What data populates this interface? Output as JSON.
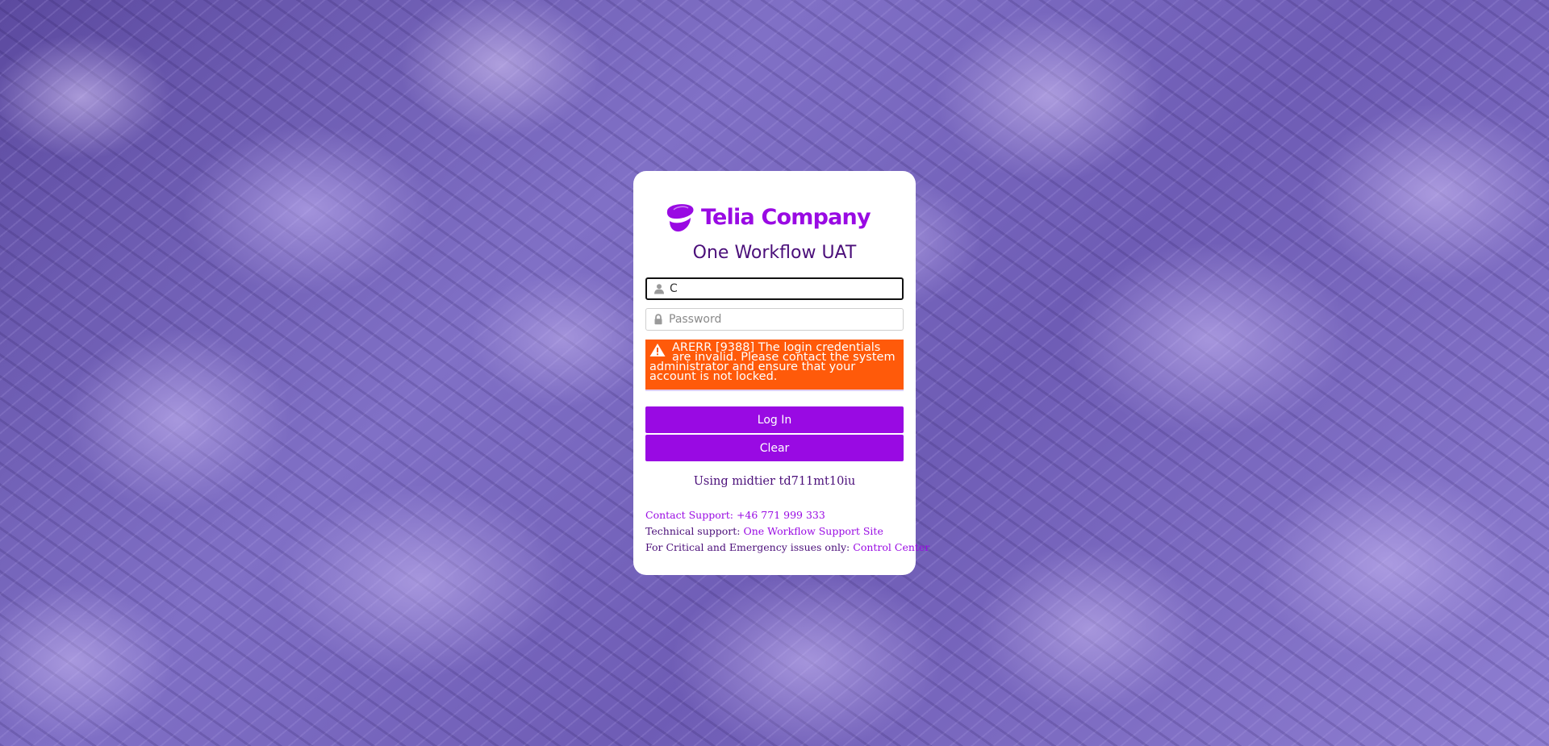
{
  "brand": {
    "logo_text": "Telia Company",
    "logo_color": "#990ae3"
  },
  "app_title": "One Workflow UAT",
  "username": {
    "icon": "user-icon",
    "value": "C",
    "placeholder": ""
  },
  "password": {
    "icon": "lock-icon",
    "value": "",
    "placeholder": "Password"
  },
  "error": {
    "icon": "warning-icon",
    "message": "ARERR [9388] The login credentials are invalid. Please contact the system administrator and ensure that your account is not locked.",
    "color": "#ff5a0a"
  },
  "buttons": {
    "login_label": "Log In",
    "clear_label": "Clear",
    "color": "#990ae3"
  },
  "midtier_text": "Using midtier td711mt10iu",
  "support": {
    "contact_text": "Contact Support: +46 771 999 333",
    "technical_prefix": "Technical support: ",
    "technical_link": "One Workflow Support Site",
    "critical_prefix": "For Critical and Emergency issues only: ",
    "critical_link": "Control Center"
  }
}
